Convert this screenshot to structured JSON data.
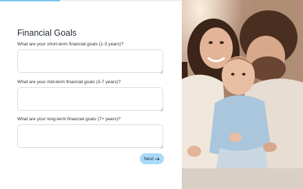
{
  "progress": {
    "fraction": 0.33
  },
  "form": {
    "title": "Financial Goals",
    "questions": [
      {
        "label": "What are your short-term financial goals (1-3 years)?",
        "value": ""
      },
      {
        "label": "What are your mid-term financial goals (3-7 years)?",
        "value": ""
      },
      {
        "label": "What are your long-term financial goals (7+ years)?",
        "value": ""
      }
    ],
    "next_label": "Next",
    "next_icon": "arrow-right-icon"
  },
  "photo": {
    "subject": "family-photo"
  },
  "colors": {
    "accent": "#a9daf7",
    "progress": "#7cc4ee",
    "title": "#1f2a33",
    "input_border": "#d6dbe0"
  }
}
